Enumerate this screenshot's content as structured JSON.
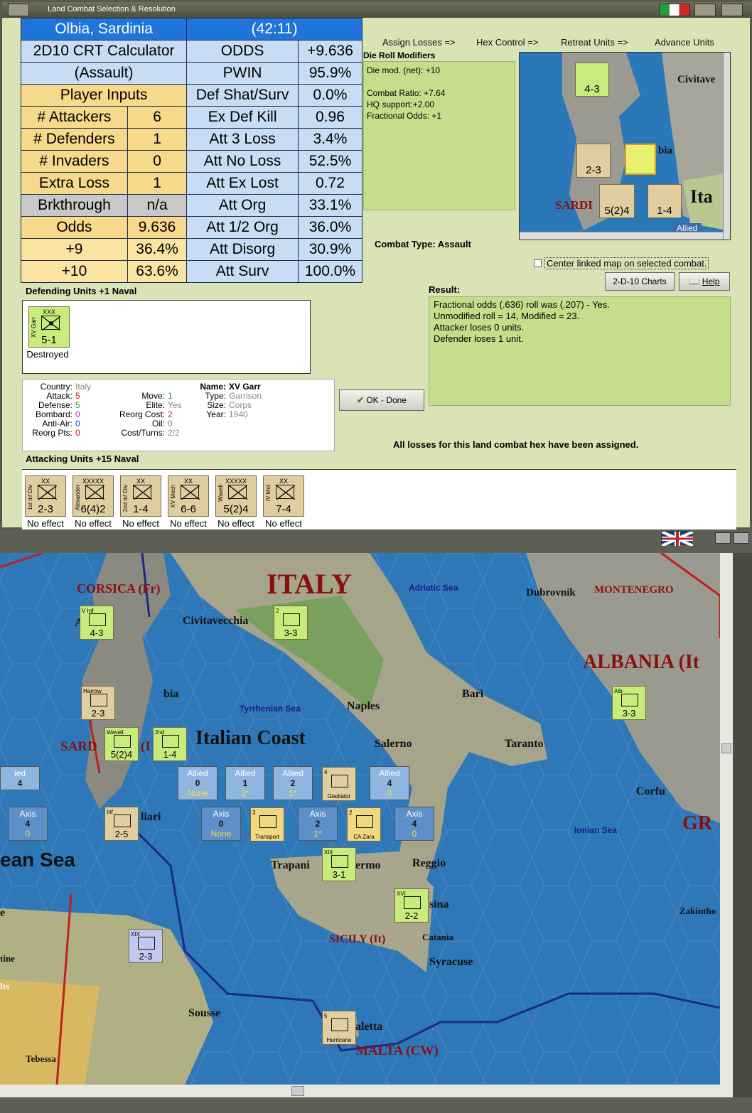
{
  "window": {
    "title": "Land Combat Selection & Resolution"
  },
  "crt": {
    "location": "Olbia, Sardinia",
    "coord": "(42:11)",
    "calc1": "2D10 CRT Calculator",
    "calc2": "(Assault)",
    "player_inputs": "Player Inputs",
    "rows": [
      {
        "l": "# Attackers",
        "v": "6"
      },
      {
        "l": "# Defenders",
        "v": "1"
      },
      {
        "l": "# Invaders",
        "v": "0"
      },
      {
        "l": "Extra Loss",
        "v": "1"
      },
      {
        "l": "Brkthrough",
        "v": "n/a"
      },
      {
        "l": "Odds",
        "v": "9.636"
      },
      {
        "l": "+9",
        "v": "36.4%"
      },
      {
        "l": "+10",
        "v": "63.6%"
      }
    ],
    "right": [
      {
        "l": "ODDS",
        "v": "+9.636"
      },
      {
        "l": "PWIN",
        "v": "95.9%"
      },
      {
        "l": "Def Shat/Surv",
        "v": "0.0%"
      },
      {
        "l": "Ex Def Kill",
        "v": "0.96"
      },
      {
        "l": "Att 3 Loss",
        "v": "3.4%"
      },
      {
        "l": "Att No Loss",
        "v": "52.5%"
      },
      {
        "l": "Att Ex Lost",
        "v": "0.72"
      },
      {
        "l": "Att Org",
        "v": "33.1%"
      },
      {
        "l": "Att 1/2 Org",
        "v": "36.0%"
      },
      {
        "l": "Att Disorg",
        "v": "30.9%"
      },
      {
        "l": "Att Surv",
        "v": "100.0%"
      }
    ]
  },
  "nav": {
    "assign": "Assign Losses =>",
    "hex": "Hex Control =>",
    "retreat": "Retreat Units =>",
    "advance": "Advance Units"
  },
  "drm": {
    "title": "Die Roll Modifiers",
    "l1": "Die mod. (net): +10",
    "l2": "Combat Ratio: +7.64",
    "l3": "HQ support:+2.00",
    "l4": "Fractional Odds: +1"
  },
  "combat_type": "Combat Type:  Assault",
  "minimap": {
    "labels": [
      "Civitave",
      "bia",
      "SARDI",
      "Ita",
      "(I"
    ],
    "allied": "Allied",
    "units": [
      {
        "v": "4-3"
      },
      {
        "v": "2-3"
      },
      {
        "v": "5(2)4"
      },
      {
        "v": "1-4"
      }
    ]
  },
  "center_link": "Center linked map on selected combat.",
  "buttons": {
    "charts": "2-D-10 Charts",
    "help": "Help",
    "ok": "OK - Done"
  },
  "result": {
    "title": "Result:",
    "lines": [
      "Fractional odds (.636) roll was (.207)  - Yes.",
      "Unmodified roll = 14, Modified = 23.",
      "Attacker loses 0 units.",
      "Defender loses 1 unit."
    ]
  },
  "defending": {
    "title": "Defending Units +1 Naval",
    "unit": {
      "size": "XXX",
      "cv": "5-1",
      "name": "XV Garr",
      "status": "Destroyed"
    }
  },
  "info": {
    "country_l": "Country:",
    "country": "Italy",
    "attack_l": "Attack:",
    "attack": "5",
    "defense_l": "Defense:",
    "defense": "5",
    "bombard_l": "Bombard:",
    "bombard": "0",
    "aa_l": "Anti-Air:",
    "aa": "0",
    "reorg_l": "Reorg Pts:",
    "reorg": "0",
    "move_l": "Move:",
    "move": "1",
    "elite_l": "Elite:",
    "elite": "Yes",
    "rcost_l": "Reorg Cost:",
    "rcost": "2",
    "oil_l": "Oil:",
    "oil": "0",
    "ct_l": "Cost/Turns:",
    "ct": "2/2",
    "name_l": "Name:",
    "name": "XV Garr",
    "type_l": "Type:",
    "type": "Garrison",
    "size_l": "Size:",
    "size": "Corps",
    "year_l": "Year:",
    "year": "1940"
  },
  "all_assigned": "All losses for this land combat hex have been assigned.",
  "attacking": {
    "title": "Attacking Units +15 Naval",
    "units": [
      {
        "name": "1st Inf Div",
        "size": "XX",
        "cv": "2-3",
        "status": "No effect"
      },
      {
        "name": "Alexander",
        "size": "XXXXX",
        "cv": "6(4)2",
        "status": "No effect"
      },
      {
        "name": "2nd Inf Div",
        "size": "XX",
        "cv": "1-4",
        "status": "No effect"
      },
      {
        "name": "XV Mech",
        "size": "XX",
        "cv": "6-6",
        "status": "No effect"
      },
      {
        "name": "Wavell",
        "size": "XXXXX",
        "cv": "5(2)4",
        "status": "No effect"
      },
      {
        "name": "IV Mot",
        "size": "XX",
        "cv": "7-4",
        "status": "No effect"
      }
    ]
  },
  "map": {
    "labels": {
      "italy": "ITALY",
      "corsica": "CORSICA (Fr)",
      "adriatic": "Adriatic Sea",
      "dubrovnik": "Dubrovnik",
      "montenegro": "MONTENEGRO",
      "albania": "ALBANIA (It",
      "civitavecchia": "Civitavecchia",
      "bia": "bia",
      "tyrrhenian": "Tyrrhenian Sea",
      "naples": "Naples",
      "bari": "Bari",
      "coast": "Italian Coast",
      "sard": "SARD",
      "ital_i": "(I",
      "salerno": "Salerno",
      "taranto": "Taranto",
      "corfu": "Corfu",
      "ionian": "Ionian Sea",
      "gr": "GR",
      "liari": "liari",
      "ean_sea": "ean Sea",
      "trapani": "Trapani",
      "ermo": "ermo",
      "reggio": "Reggio",
      "sina": "sina",
      "sicily": "SICILY (It)",
      "catania": "Catania",
      "syracuse": "Syracuse",
      "zakintho": "Zakintho",
      "sousse": "Sousse",
      "tebessa": "Tebessa",
      "aletta": "aletta",
      "malta": "MALTA (CW)",
      "tine": "tine",
      "its": "lts",
      "e": "e",
      "a": "A"
    },
    "units": [
      {
        "cv": "4-3",
        "tag": "V Inf"
      },
      {
        "cv": "3-3",
        "tag": "2"
      },
      {
        "cv": "3-3",
        "tag": "Alb"
      },
      {
        "cv": "2-3",
        "tag": "Harrow"
      },
      {
        "cv": "5(2)4",
        "tag": "Wavell"
      },
      {
        "cv": "1-4",
        "tag": "2nd"
      },
      {
        "cv": "2-5",
        "tag": "Inf"
      },
      {
        "cv": "3-1",
        "tag": "XIII"
      },
      {
        "cv": "2-2",
        "tag": "XVI"
      },
      {
        "cv": "2-3",
        "tag": "XIX"
      },
      {
        "cv": "Gladiator",
        "tag": "4"
      },
      {
        "cv": "Transport",
        "tag": "3"
      },
      {
        "cv": "CA Zara",
        "tag": "2"
      },
      {
        "cv": "Hurricane",
        "tag": "5"
      }
    ],
    "stacks": [
      {
        "h": "Allied",
        "a": "0",
        "b": "None"
      },
      {
        "h": "Allied",
        "a": "1",
        "b": "2*"
      },
      {
        "h": "Allied",
        "a": "2",
        "b": "1*"
      },
      {
        "h": "Allied",
        "a": "4",
        "b": "0"
      },
      {
        "h": "Axis",
        "a": "0",
        "b": "None"
      },
      {
        "h": "Axis",
        "a": "2",
        "b": "1*"
      },
      {
        "h": "Axis",
        "a": "4",
        "b": "0"
      },
      {
        "h": "Axis",
        "a": "4",
        "b": "0"
      },
      {
        "h": "ied",
        "a": "4",
        "b": ""
      }
    ]
  }
}
